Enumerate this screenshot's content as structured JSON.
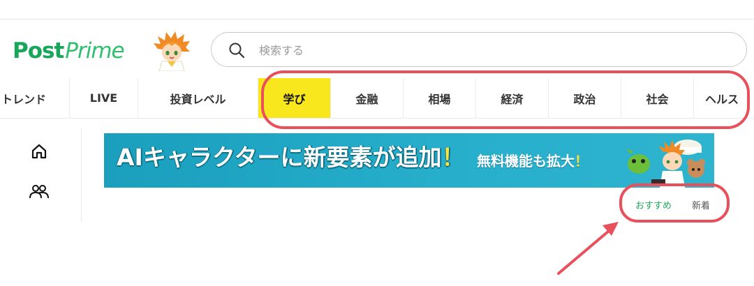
{
  "header": {
    "logo_post": "Post",
    "logo_prime": "Prime",
    "search_placeholder": "検索する"
  },
  "categories": [
    {
      "label": "トレンド",
      "active": false
    },
    {
      "label": "LIVE",
      "active": false
    },
    {
      "label": "投資レベル",
      "active": false
    },
    {
      "label": "学び",
      "active": true
    },
    {
      "label": "金融",
      "active": false
    },
    {
      "label": "相場",
      "active": false
    },
    {
      "label": "経済",
      "active": false
    },
    {
      "label": "政治",
      "active": false
    },
    {
      "label": "社会",
      "active": false
    },
    {
      "label": "ヘルス",
      "active": false
    }
  ],
  "sidebar": {
    "items": [
      {
        "icon": "home-icon"
      },
      {
        "icon": "users-icon"
      }
    ]
  },
  "banner": {
    "title": "AIキャラクターに新要素が追加",
    "title_mark": "！",
    "subtitle": "無料機能も拡大",
    "subtitle_mark": "！"
  },
  "feed_tabs": {
    "recommended": "おすすめ",
    "latest": "新着"
  },
  "colors": {
    "brand_green": "#17a65a",
    "active_tab": "#f8e71c",
    "annotation_red": "#e8505b",
    "banner_blue": "#26aecb"
  }
}
